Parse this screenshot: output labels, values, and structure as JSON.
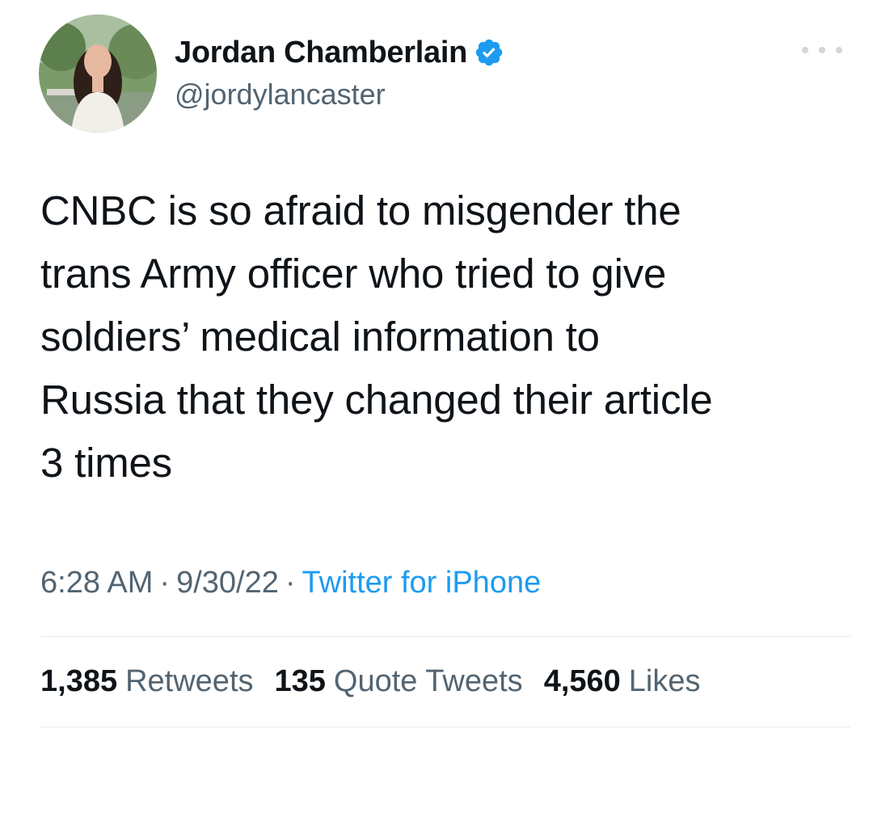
{
  "author": {
    "display_name": "Jordan Chamberlain",
    "handle": "@jordylancaster",
    "verified": true,
    "avatar_icon": "profile-photo",
    "verified_icon": "verified-badge-icon"
  },
  "tweet": {
    "text": "CNBC is so afraid to misgender the\ntrans Army officer who tried to give\nsoldiers’ medical information to\nRussia that they changed their article\n3 times",
    "time": "6:28 AM",
    "date": "9/30/22",
    "source": "Twitter for iPhone",
    "separator": "·"
  },
  "stats": {
    "retweets": {
      "count": "1,385",
      "label": "Retweets"
    },
    "quotes": {
      "count": "135",
      "label": "Quote Tweets"
    },
    "likes": {
      "count": "4,560",
      "label": "Likes"
    }
  },
  "colors": {
    "text": "#0f1419",
    "secondary": "#536471",
    "accent": "#1d9bf0",
    "divider": "#e6e9eb"
  }
}
